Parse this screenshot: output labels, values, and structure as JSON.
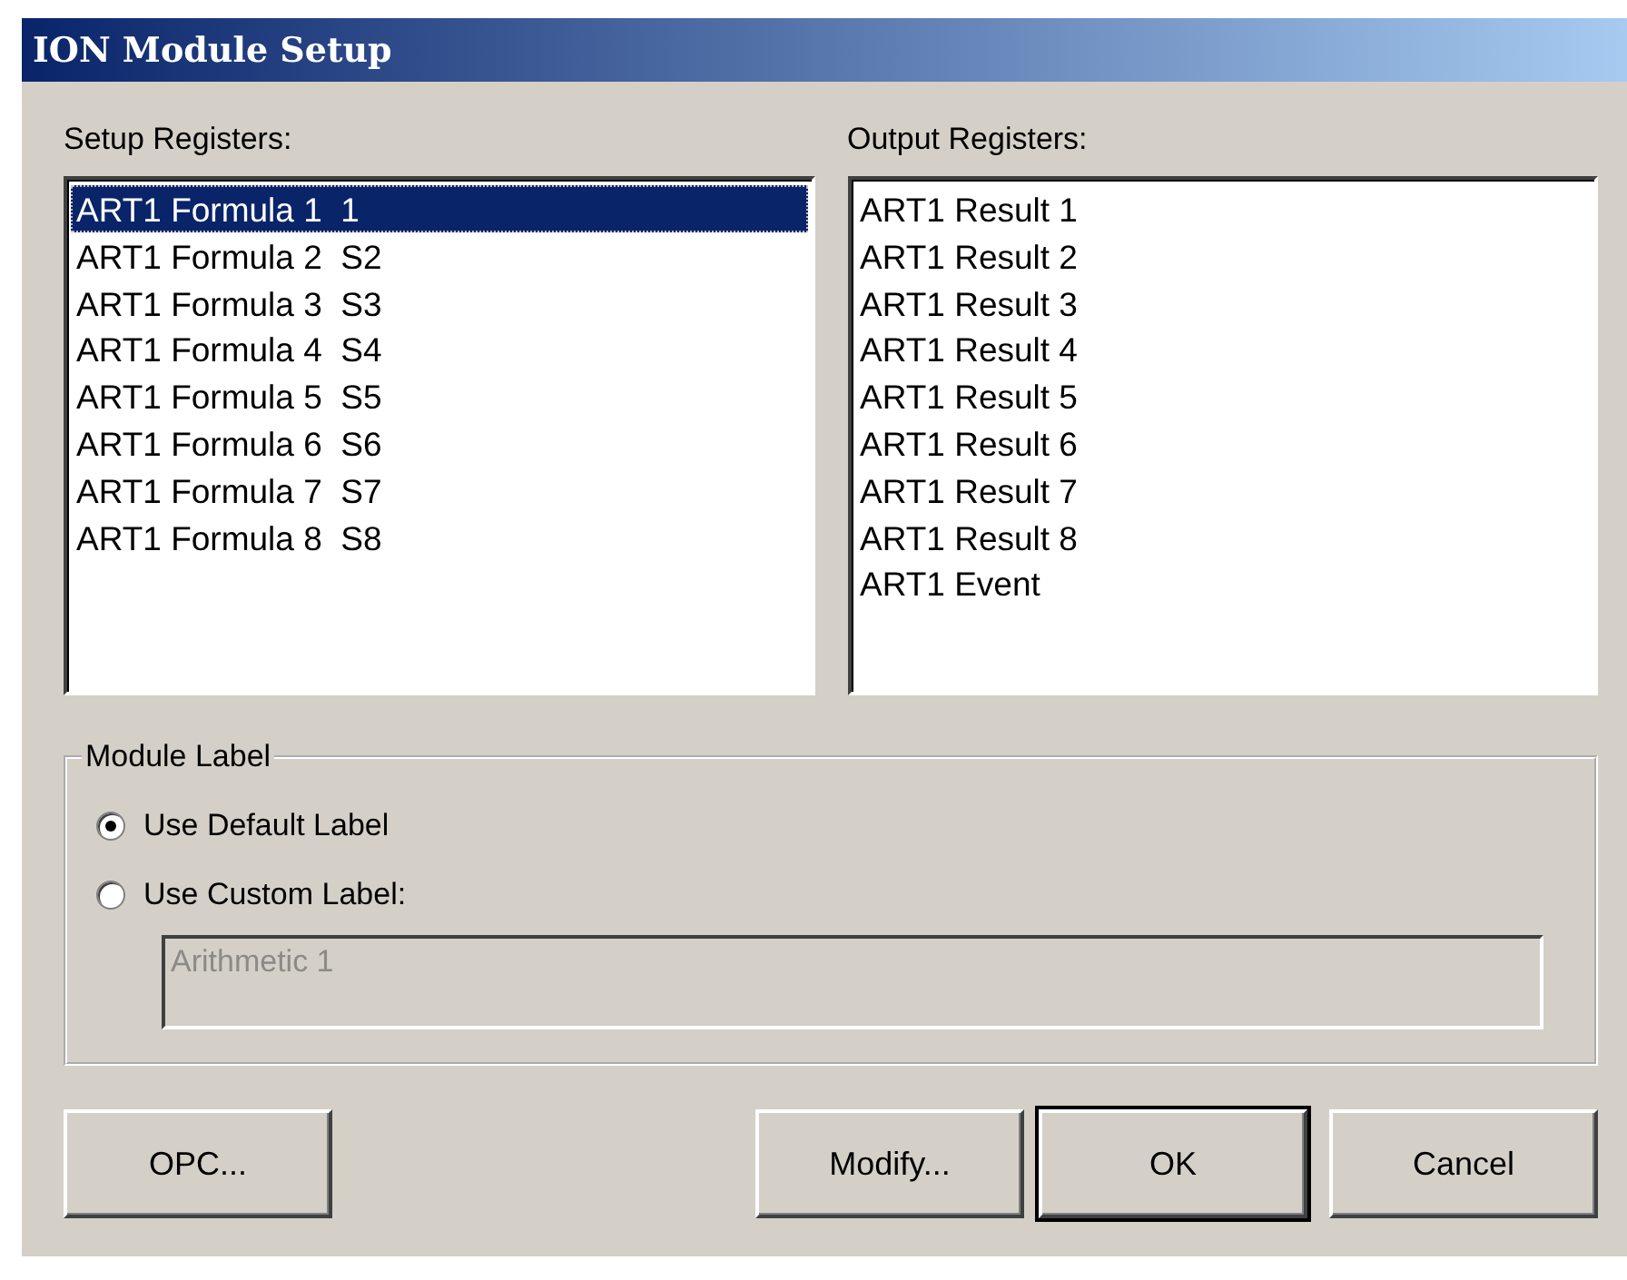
{
  "window": {
    "title": "ION Module Setup"
  },
  "setup_registers": {
    "label": "Setup Registers:",
    "items": [
      {
        "text": "ART1 Formula 1  1",
        "selected": true
      },
      {
        "text": "ART1 Formula 2  S2",
        "selected": false
      },
      {
        "text": "ART1 Formula 3  S3",
        "selected": false
      },
      {
        "text": "ART1 Formula 4  S4",
        "selected": false
      },
      {
        "text": "ART1 Formula 5  S5",
        "selected": false
      },
      {
        "text": "ART1 Formula 6  S6",
        "selected": false
      },
      {
        "text": "ART1 Formula 7  S7",
        "selected": false
      },
      {
        "text": "ART1 Formula 8  S8",
        "selected": false
      }
    ]
  },
  "output_registers": {
    "label": "Output Registers:",
    "items": [
      {
        "text": "ART1 Result 1",
        "selected": false
      },
      {
        "text": "ART1 Result 2",
        "selected": false
      },
      {
        "text": "ART1 Result 3",
        "selected": false
      },
      {
        "text": "ART1 Result 4",
        "selected": false
      },
      {
        "text": "ART1 Result 5",
        "selected": false
      },
      {
        "text": "ART1 Result 6",
        "selected": false
      },
      {
        "text": "ART1 Result 7",
        "selected": false
      },
      {
        "text": "ART1 Result 8",
        "selected": false
      },
      {
        "text": "ART1 Event",
        "selected": false
      }
    ]
  },
  "module_label": {
    "title": "Module Label",
    "options": [
      {
        "label": "Use Default Label",
        "selected": true
      },
      {
        "label": "Use Custom Label:",
        "selected": false
      }
    ],
    "custom_label": {
      "value": "Arithmetic 1",
      "disabled": true
    }
  },
  "buttons": [
    {
      "label": "OPC...",
      "default": false
    },
    {
      "label": "Modify...",
      "default": false
    },
    {
      "label": "OK",
      "default": true
    },
    {
      "label": "Cancel",
      "default": false
    }
  ]
}
